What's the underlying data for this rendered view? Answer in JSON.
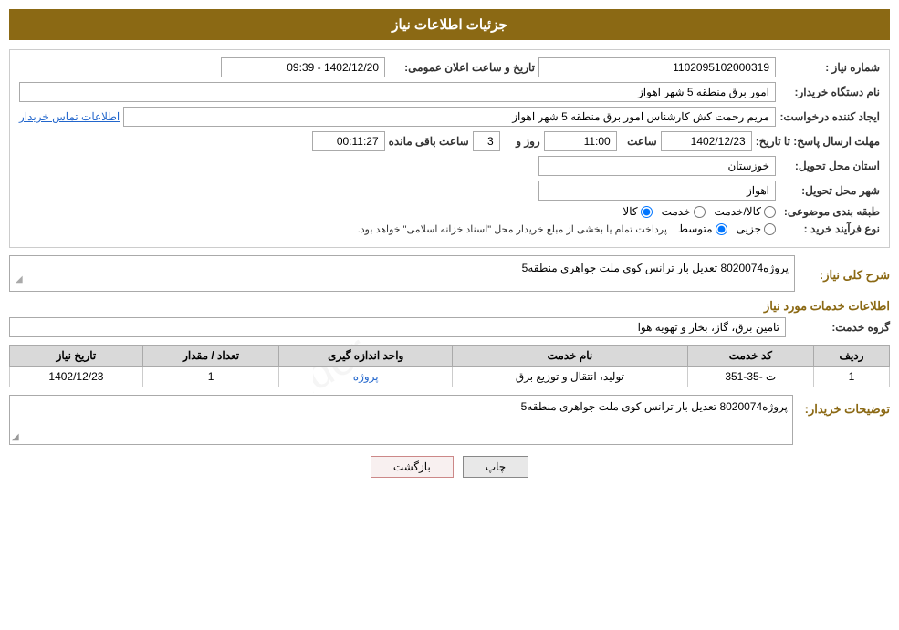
{
  "header": {
    "title": "جزئیات اطلاعات نیاز"
  },
  "fields": {
    "need_number_label": "شماره نیاز :",
    "need_number_value": "1102095102000319",
    "buyer_label": "نام دستگاه خریدار:",
    "buyer_value": "امور برق منطقه 5 شهر اهواز",
    "requester_label": "ایجاد کننده درخواست:",
    "requester_value": "مریم رحمت کش کارشناس امور برق منطقه 5 شهر اهواز",
    "contact_link": "اطلاعات تماس خریدار",
    "deadline_label": "مهلت ارسال پاسخ: تا تاریخ:",
    "date_value": "1402/12/23",
    "time_label": "ساعت",
    "time_value": "11:00",
    "days_label": "روز و",
    "days_value": "3",
    "remaining_label": "ساعت باقی مانده",
    "remaining_value": "00:11:27",
    "announce_label": "تاریخ و ساعت اعلان عمومی:",
    "announce_value": "1402/12/20 - 09:39",
    "province_label": "استان محل تحویل:",
    "province_value": "خوزستان",
    "city_label": "شهر محل تحویل:",
    "city_value": "اهواز",
    "category_label": "طبقه بندی موضوعی:",
    "category_goods": "کالا",
    "category_service": "خدمت",
    "category_goods_service": "کالا/خدمت",
    "purchase_type_label": "نوع فرآیند خرید :",
    "purchase_partial": "جزیی",
    "purchase_medium": "متوسط",
    "purchase_note": "پرداخت تمام یا بخشی از مبلغ خریدار محل \"اسناد خزانه اسلامی\" خواهد بود.",
    "need_desc_label": "شرح کلی نیاز:",
    "need_desc_value": "پروژه8020074 تعدیل بار ترانس کوی ملت جواهری منطقه5",
    "service_info_title": "اطلاعات خدمات مورد نیاز",
    "service_group_label": "گروه خدمت:",
    "service_group_value": "تامین برق، گاز، بخار و تهویه هوا",
    "table": {
      "headers": [
        "ردیف",
        "کد خدمت",
        "نام خدمت",
        "واحد اندازه گیری",
        "تعداد / مقدار",
        "تاریخ نیاز"
      ],
      "rows": [
        {
          "row": "1",
          "code": "ت -35-351",
          "name": "تولید، انتقال و توزیع برق",
          "unit_link": "پروژه",
          "quantity": "1",
          "date": "1402/12/23"
        }
      ]
    },
    "buyer_desc_label": "توضیحات خریدار:",
    "buyer_desc_value": "پروژه8020074 تعدیل بار ترانس کوی ملت جواهری منطقه5",
    "btn_print": "چاپ",
    "btn_back": "بازگشت"
  }
}
